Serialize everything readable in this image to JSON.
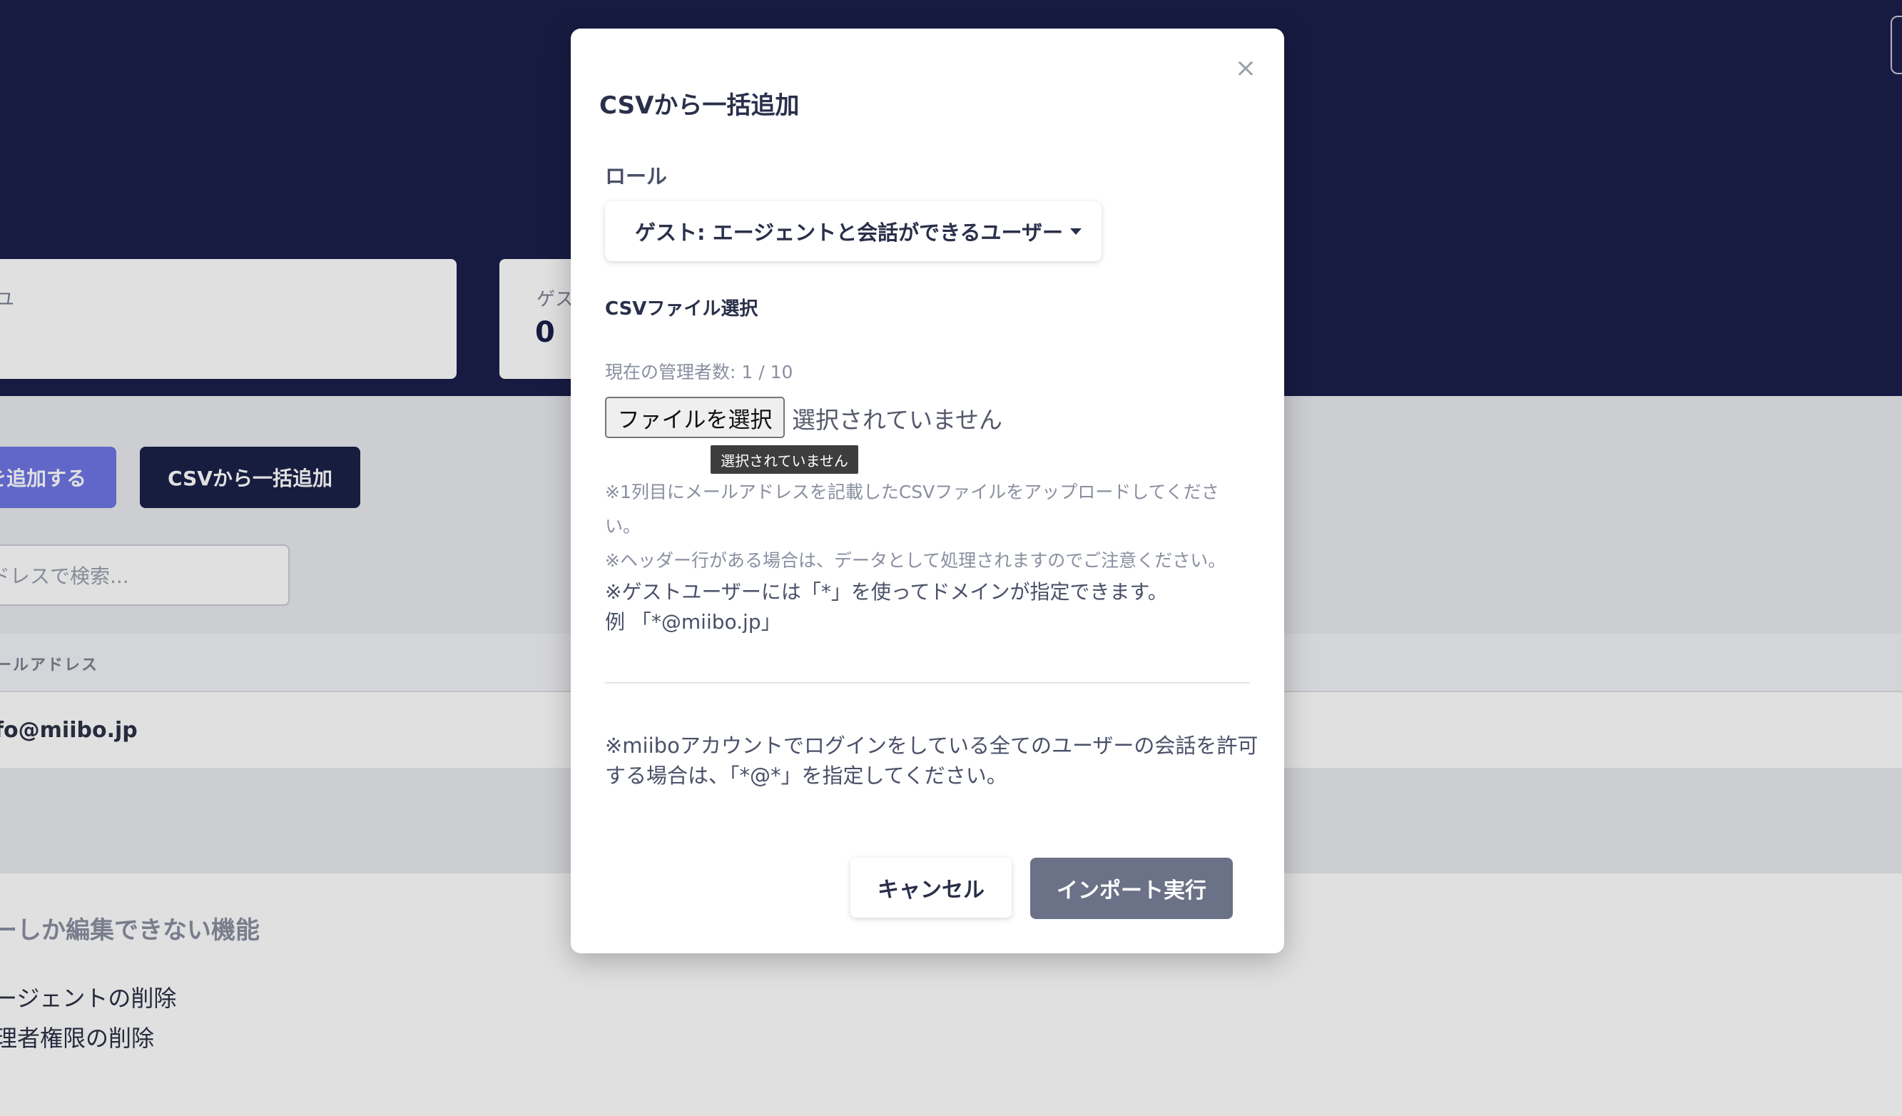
{
  "background": {
    "stat_cards": [
      {
        "label": "ユ",
        "value": ""
      },
      {
        "label": "ゲス",
        "value": "0"
      }
    ],
    "add_button_label": "を追加する",
    "csv_button_label": "CSVから一括追加",
    "search_placeholder": "ドレスで検索...",
    "table_header": "ールアドレス",
    "table_row_email": "fo@miibo.jp",
    "section_title": "ーしか編集できない機能",
    "section_items": [
      "ージェントの削除",
      "理者権限の削除"
    ]
  },
  "modal": {
    "title": "CSVから一括追加",
    "close_symbol": "×",
    "role_label": "ロール",
    "role_selected": "ゲスト: エージェントと会話ができるユーザー",
    "csv_label": "CSVファイル選択",
    "admin_count": "現在の管理者数: 1 / 10",
    "file_button": "ファイルを選択",
    "file_status": "選択されていません",
    "tooltip": "選択されていません",
    "notes": [
      "※1列目にメールアドレスを記載したCSVファイルをアップロードしてくださ",
      "い。",
      "※ヘッダー行がある場合は、データとして処理されますのでご注意ください。"
    ],
    "notes_dark": [
      "※ゲストユーザーには「*」を使ってドメインが指定できます。",
      "例 「*@miibo.jp」"
    ],
    "notes_bottom": [
      "※miiboアカウントでログインをしている全てのユーザーの会話を許可",
      "する場合は、「*@*」を指定してください。"
    ],
    "cancel_label": "キャンセル",
    "import_label": "インポート実行"
  },
  "colors": {
    "header_bg": "#1b1f4a",
    "primary_accent": "#6e76e5",
    "dark_button": "#1b2148",
    "import_button": "#6b7186"
  }
}
